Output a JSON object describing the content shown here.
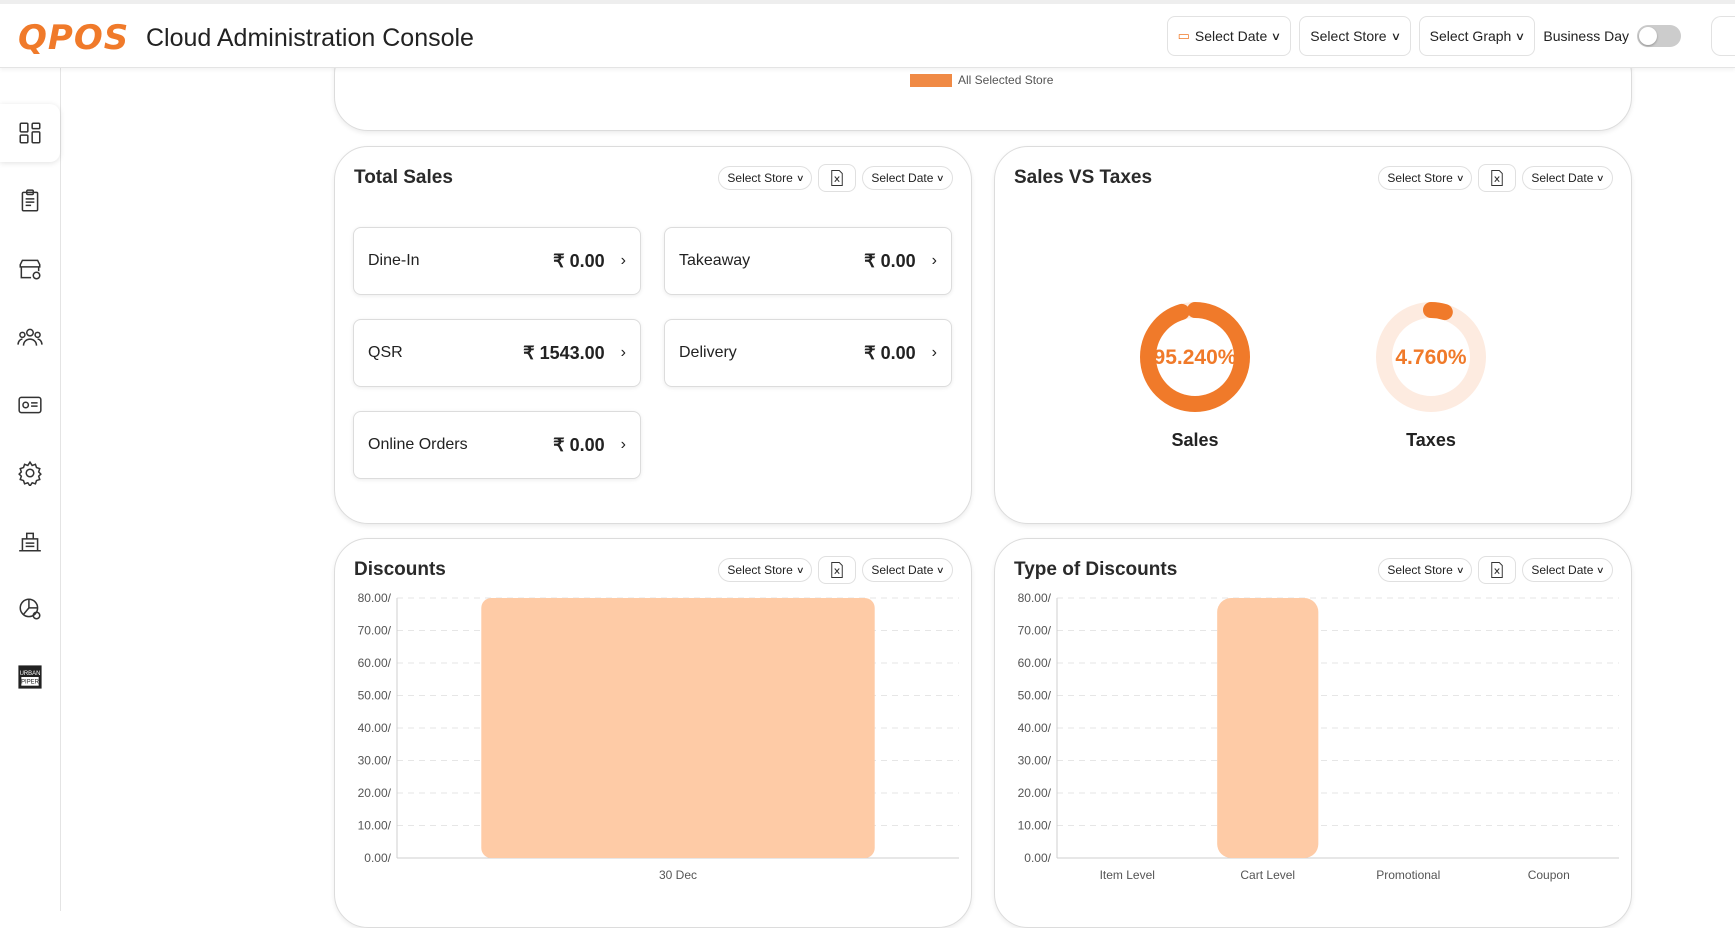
{
  "header": {
    "logo": "QPOS",
    "title": "Cloud Administration Console",
    "select_date": "Select Date",
    "select_store": "Select Store",
    "select_graph": "Select Graph",
    "business_day": "Business Day",
    "business_day_on": false
  },
  "sidebar": {
    "items": [
      {
        "icon": "dashboard-icon",
        "active": true
      },
      {
        "icon": "menu-clipboard-icon"
      },
      {
        "icon": "store-settings-icon"
      },
      {
        "icon": "users-group-icon"
      },
      {
        "icon": "id-card-icon"
      },
      {
        "icon": "gear-icon"
      },
      {
        "icon": "warehouse-icon"
      },
      {
        "icon": "reports-icon"
      },
      {
        "icon": "urban-piper-icon",
        "label": "URBAN PIPER"
      }
    ]
  },
  "top_card": {
    "legend": "All Selected Store",
    "legend_color": "#f08a45"
  },
  "tools": {
    "select_store": "Select Store",
    "select_date": "Select Date"
  },
  "total_sales": {
    "title": "Total Sales",
    "tiles": [
      {
        "label": "Dine-In",
        "value": "₹ 0.00"
      },
      {
        "label": "Takeaway",
        "value": "₹ 0.00"
      },
      {
        "label": "QSR",
        "value": "₹ 1543.00"
      },
      {
        "label": "Delivery",
        "value": "₹ 0.00"
      },
      {
        "label": "Online Orders",
        "value": "₹ 0.00"
      }
    ]
  },
  "sales_vs_taxes": {
    "title": "Sales VS Taxes",
    "sales_label": "Sales",
    "sales_text": "95.240%",
    "sales_fraction": 0.9524,
    "taxes_label": "Taxes",
    "taxes_text": "4.760%",
    "taxes_fraction": 0.0476,
    "accent": "#f07a2a",
    "track": "#fdebe0"
  },
  "discounts": {
    "title": "Discounts"
  },
  "type_of_discounts": {
    "title": "Type of Discounts"
  },
  "chart_data": [
    {
      "type": "bar",
      "title": "Discounts",
      "categories": [
        "30 Dec"
      ],
      "values": [
        80
      ],
      "ylim": [
        0,
        80
      ],
      "yticks": [
        "0.00/",
        "10.00/",
        "20.00/",
        "30.00/",
        "40.00/",
        "50.00/",
        "60.00/",
        "70.00/",
        "80.00/"
      ],
      "color": "#fecba6",
      "grid": true
    },
    {
      "type": "bar",
      "title": "Type of Discounts",
      "categories": [
        "Item Level",
        "Cart Level",
        "Promotional",
        "Coupon"
      ],
      "values": [
        0,
        80,
        0,
        0
      ],
      "ylim": [
        0,
        80
      ],
      "yticks": [
        "0.00/",
        "10.00/",
        "20.00/",
        "30.00/",
        "40.00/",
        "50.00/",
        "60.00/",
        "70.00/",
        "80.00/"
      ],
      "color": "#fecba6",
      "grid": true
    }
  ]
}
